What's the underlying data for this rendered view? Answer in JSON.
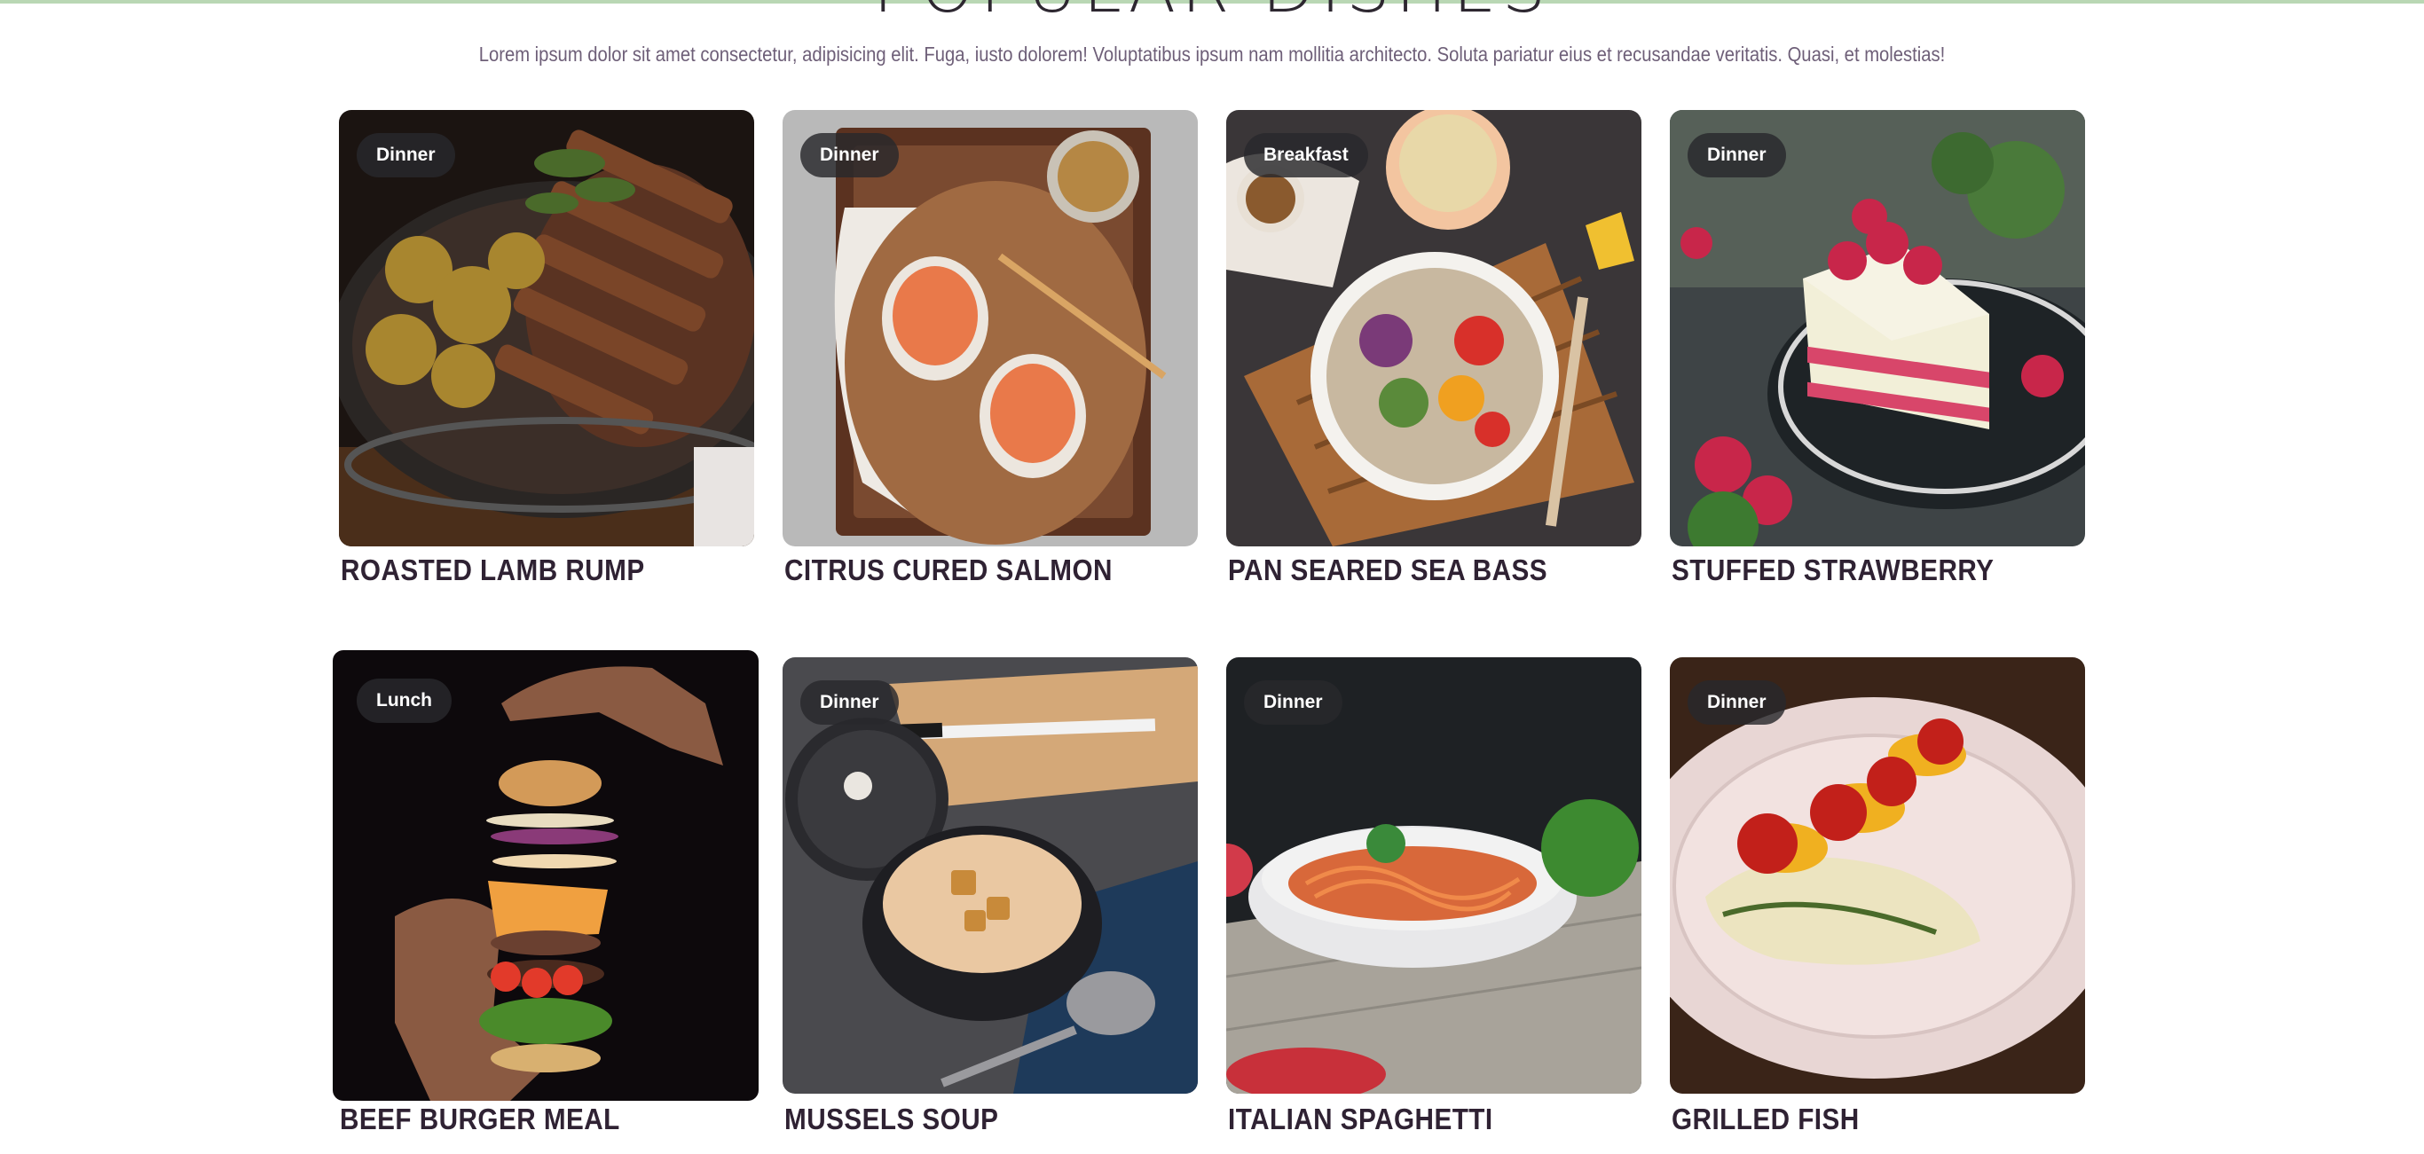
{
  "section": {
    "title": "POPULAR DISHES",
    "subtitle": "Lorem ipsum dolor sit amet consectetur, adipisicing elit. Fuga, iusto dolorem! Voluptatibus ipsum nam mollitia architecto. Soluta pariatur eius et recusandae veritatis. Quasi, et molestias!"
  },
  "dishes": [
    {
      "category": "Dinner",
      "name": "ROASTED LAMB RUMP",
      "image_icon": "steak-potatoes-image"
    },
    {
      "category": "Dinner",
      "name": "CITRUS CURED SALMON",
      "image_icon": "salmon-toast-image"
    },
    {
      "category": "Breakfast",
      "name": "PAN SEARED SEA BASS",
      "image_icon": "salad-bowl-image"
    },
    {
      "category": "Dinner",
      "name": "STUFFED STRAWBERRY",
      "image_icon": "strawberry-cake-image"
    },
    {
      "category": "Lunch",
      "name": "BEEF BURGER MEAL",
      "image_icon": "floating-burger-image"
    },
    {
      "category": "Dinner",
      "name": "MUSSELS SOUP",
      "image_icon": "soup-pot-image"
    },
    {
      "category": "Dinner",
      "name": "ITALIAN SPAGHETTI",
      "image_icon": "spaghetti-bowl-image"
    },
    {
      "category": "Dinner",
      "name": "GRILLED FISH",
      "image_icon": "grilled-fish-plate-image"
    }
  ],
  "colors": {
    "accent_line": "#b9d7b4",
    "title": "#2f2233",
    "subtitle": "#6e5f78",
    "badge_bg": "#28282c"
  }
}
